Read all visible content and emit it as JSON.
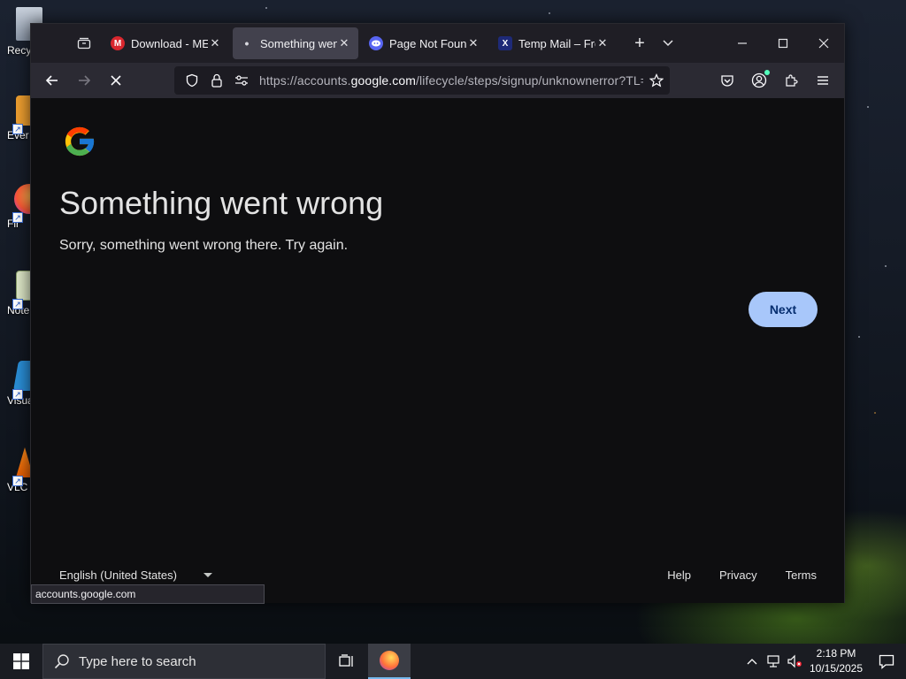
{
  "desktop": {
    "icons": [
      {
        "label": "Recy"
      },
      {
        "label": "Ever"
      },
      {
        "label": "Fir"
      },
      {
        "label": "Note"
      },
      {
        "label": "Visua"
      },
      {
        "label": "VLC"
      }
    ]
  },
  "browser": {
    "tabs": [
      {
        "title": "Download - MEGA",
        "favicon": "M",
        "color": "#d9272e",
        "active": false
      },
      {
        "title": "Something went wrong",
        "favicon": "•",
        "color": "#42414d",
        "active": true
      },
      {
        "title": "Page Not Found",
        "favicon": "D",
        "color": "#5865f2",
        "active": false
      },
      {
        "title": "Temp Mail – Free",
        "favicon": "X",
        "color": "#1e2a78",
        "active": false
      }
    ],
    "url_prefix": "https://accounts.",
    "url_domain": "google.com",
    "url_path": "/lifecycle/steps/signup/unknownerror?TL=A",
    "status_text": "accounts.google.com"
  },
  "page": {
    "headline": "Something went wrong",
    "subtext": "Sorry, something went wrong there. Try again.",
    "next_label": "Next",
    "language": "English (United States)",
    "footer": {
      "help": "Help",
      "privacy": "Privacy",
      "terms": "Terms"
    }
  },
  "taskbar": {
    "search_placeholder": "Type here to search",
    "time": "2:18 PM",
    "date": "10/15/2025"
  },
  "colors": {
    "accent_button": "#a8c7fa",
    "google_blue": "#4285f4",
    "google_red": "#ea4335",
    "google_yellow": "#fbbc05",
    "google_green": "#34a853"
  }
}
